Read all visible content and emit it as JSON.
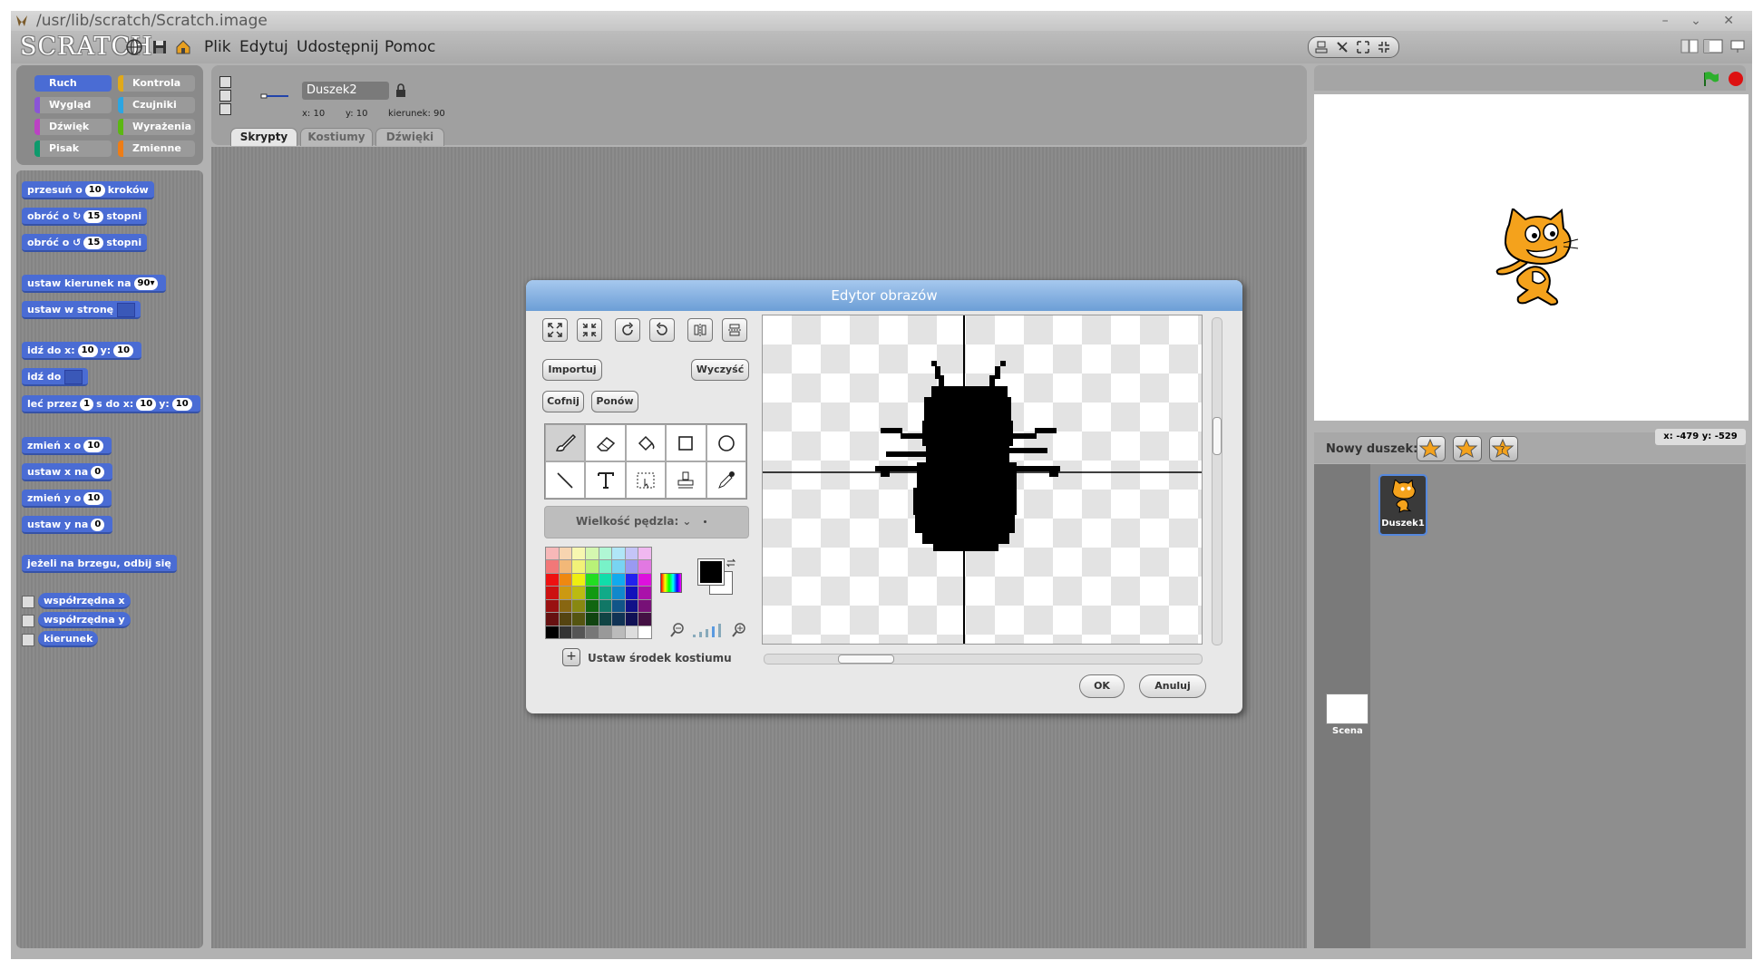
{
  "window": {
    "title": "/usr/lib/scratch/Scratch.image",
    "controls": "– ⌄ ✕"
  },
  "logo": "SCRATCH",
  "menu": [
    "Plik",
    "Edytuj",
    "Udostępnij",
    "Pomoc"
  ],
  "categories": [
    {
      "label": "Ruch",
      "color": "#4a6cd4",
      "selected": true
    },
    {
      "label": "Kontrola",
      "color": "#e1a91a"
    },
    {
      "label": "Wygląd",
      "color": "#8a55d7"
    },
    {
      "label": "Czujniki",
      "color": "#2ca5e2"
    },
    {
      "label": "Dźwięk",
      "color": "#bb42c3"
    },
    {
      "label": "Wyrażenia",
      "color": "#5cb712"
    },
    {
      "label": "Pisak",
      "color": "#0e9a6c"
    },
    {
      "label": "Zmienne",
      "color": "#ee7d16"
    }
  ],
  "blocks": {
    "move": {
      "a": "przesuń o",
      "n": "10",
      "b": "kroków"
    },
    "turn_right": {
      "a": "obróć o",
      "icon": "↻",
      "n": "15",
      "b": "stopni"
    },
    "turn_left": {
      "a": "obróć o",
      "icon": "↺",
      "n": "15",
      "b": "stopni"
    },
    "point_dir": {
      "a": "ustaw kierunek na",
      "n": "90▾"
    },
    "point_towards": {
      "a": "ustaw w stronę"
    },
    "goto_xy": {
      "a": "idź do x:",
      "x": "10",
      "m": "y:",
      "y": "10"
    },
    "goto": {
      "a": "idź do"
    },
    "glide": {
      "a": "leć przez",
      "s": "1",
      "m": "s do x:",
      "x": "10",
      "m2": "y:",
      "y": "10"
    },
    "change_x": {
      "a": "zmień x o",
      "n": "10"
    },
    "set_x": {
      "a": "ustaw x na",
      "n": "0"
    },
    "change_y": {
      "a": "zmień y o",
      "n": "10"
    },
    "set_y": {
      "a": "ustaw y na",
      "n": "0"
    },
    "bounce": {
      "a": "jeżeli na brzegu, odbij się"
    },
    "rep_x": {
      "a": "współrzędna x"
    },
    "rep_y": {
      "a": "współrzędna y"
    },
    "rep_dir": {
      "a": "kierunek"
    }
  },
  "sprite_info": {
    "name": "Duszek2",
    "x": "x: 10",
    "y": "y: 10",
    "direction": "kierunek: 90"
  },
  "tabs": [
    "Skrypty",
    "Kostiumy",
    "Dźwięki"
  ],
  "dialog": {
    "title": "Edytor obrazów",
    "import": "Importuj",
    "clear": "Wyczyść",
    "undo": "Cofnij",
    "redo": "Ponów",
    "brush_size": "Wielkość pędzla: ⌄",
    "set_center": "Ustaw środek kostiumu",
    "ok": "OK",
    "cancel": "Anuluj"
  },
  "palette_colors": [
    "#f7b8b8",
    "#f7d4b0",
    "#f7f7b0",
    "#d4f7b0",
    "#b0f7d4",
    "#b0e6f7",
    "#c4c4f7",
    "#f0b8f0",
    "#f27878",
    "#f2b878",
    "#f2f278",
    "#b8f278",
    "#78f2c8",
    "#78d4f2",
    "#9a9af2",
    "#e278e2",
    "#ee1111",
    "#ee8811",
    "#eeee11",
    "#22dd22",
    "#11ddaa",
    "#11aaee",
    "#2222ee",
    "#dd11dd",
    "#cc1111",
    "#cc9911",
    "#bbbb11",
    "#119911",
    "#11aa88",
    "#1188cc",
    "#1111bb",
    "#aa11aa",
    "#991111",
    "#886611",
    "#888811",
    "#116611",
    "#117766",
    "#115588",
    "#111188",
    "#771177",
    "#661111",
    "#554411",
    "#555511",
    "#114411",
    "#114444",
    "#113355",
    "#111155",
    "#441144",
    "#000000",
    "#333333",
    "#555555",
    "#777777",
    "#999999",
    "#bbbbbb",
    "#dddddd",
    "#ffffff"
  ],
  "sprite_panel": {
    "new_sprite": "Nowy duszek:",
    "coords": "x: -479  y: -529"
  },
  "sprites": [
    {
      "name": "Duszek1"
    }
  ],
  "stage_label": "Scena",
  "colors": {
    "motion": "#4a6cd4",
    "green_flag": "#2db02d",
    "stop": "#dd1111"
  }
}
